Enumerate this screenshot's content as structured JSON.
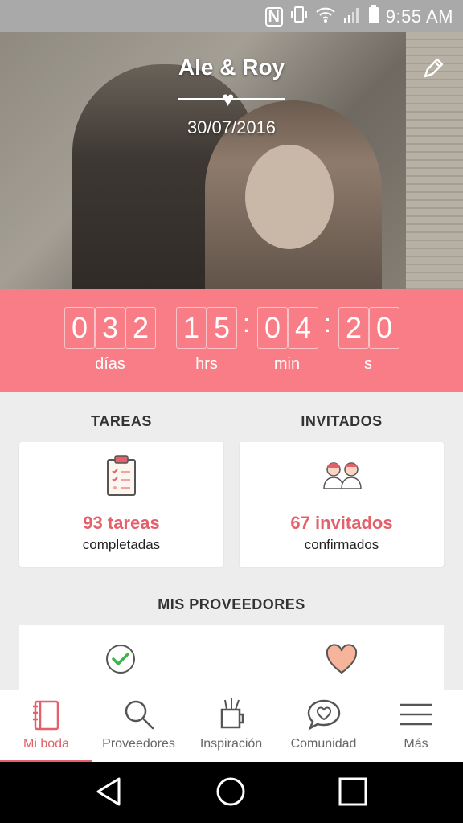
{
  "status_bar": {
    "time": "9:55 AM"
  },
  "hero": {
    "names": "Ale & Roy",
    "date": "30/07/2016"
  },
  "countdown": {
    "days": [
      "0",
      "3",
      "2"
    ],
    "hours": [
      "1",
      "5"
    ],
    "minutes": [
      "0",
      "4"
    ],
    "seconds": [
      "2",
      "0"
    ],
    "labels": {
      "days": "días",
      "hours": "hrs",
      "minutes": "min",
      "seconds": "s"
    }
  },
  "tasks": {
    "title": "TAREAS",
    "count": "93 tareas",
    "subtitle": "completadas"
  },
  "guests": {
    "title": "INVITADOS",
    "count": "67 invitados",
    "subtitle": "confirmados"
  },
  "vendors": {
    "title": "MIS PROVEEDORES"
  },
  "tabbar": {
    "items": [
      {
        "label": "Mi boda",
        "icon": "notebook-icon"
      },
      {
        "label": "Proveedores",
        "icon": "search-icon"
      },
      {
        "label": "Inspiración",
        "icon": "pencil-cup-icon"
      },
      {
        "label": "Comunidad",
        "icon": "chat-heart-icon"
      },
      {
        "label": "Más",
        "icon": "menu-icon"
      }
    ]
  },
  "colors": {
    "accent": "#f97d86",
    "accent_text": "#e4616b",
    "background": "#ededed"
  }
}
